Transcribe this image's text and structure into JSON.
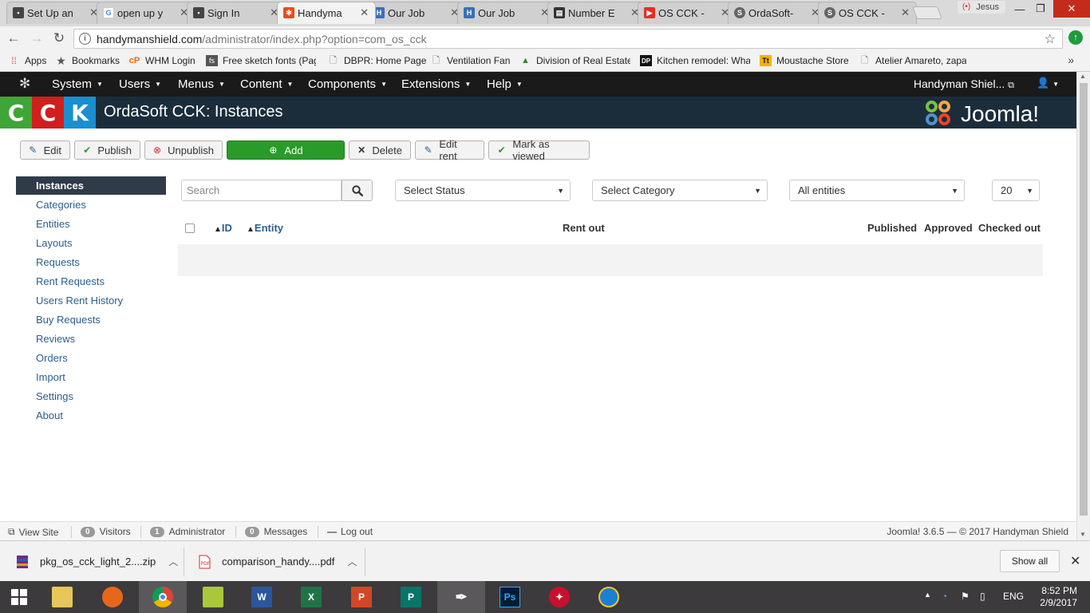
{
  "browser": {
    "tabs": [
      {
        "label": "Set Up an",
        "icon": "square-icon",
        "color": "#444444"
      },
      {
        "label": "open up y",
        "icon": "google-icon",
        "color": "#4285f4"
      },
      {
        "label": "Sign In",
        "icon": "square-icon",
        "color": "#444444"
      },
      {
        "label": "Handyma",
        "icon": "joomla-icon",
        "color": "#e84c1e"
      },
      {
        "label": "Our Job",
        "icon": "shield-icon",
        "color": "#3b6fb6"
      },
      {
        "label": "Our Job",
        "icon": "shield-icon",
        "color": "#3b6fb6"
      },
      {
        "label": "Number E",
        "icon": "book-icon",
        "color": "#333333"
      },
      {
        "label": "OS CCK -",
        "icon": "youtube-icon",
        "color": "#e52d27"
      },
      {
        "label": "OrdaSoft-",
        "icon": "ordasoft-icon",
        "color": "#666666"
      },
      {
        "label": "OS CCK -",
        "icon": "ordasoft-icon",
        "color": "#666666"
      }
    ],
    "profile_name": "Jesus",
    "url_host": "handymanshield.com",
    "url_path": "/administrator/index.php?option=com_os_cck",
    "bookmarks": [
      {
        "label": "Apps",
        "icon": "apps-grid-icon"
      },
      {
        "label": "Bookmarks",
        "icon": "star-icon"
      },
      {
        "label": "WHM Login",
        "icon": "cpanel-icon"
      },
      {
        "label": "Free sketch fonts (Pag",
        "icon": "fs-icon"
      },
      {
        "label": "DBPR: Home Page",
        "icon": "page-icon"
      },
      {
        "label": "Ventilation Fan",
        "icon": "page-icon"
      },
      {
        "label": "Division of Real Estate",
        "icon": "triangle-icon"
      },
      {
        "label": "Kitchen remodel: Wha",
        "icon": "dp-icon"
      },
      {
        "label": "Moustache Store",
        "icon": "tt-icon"
      },
      {
        "label": "Atelier Amareto, zapa",
        "icon": "page-icon"
      }
    ]
  },
  "joomla": {
    "menu": [
      "System",
      "Users",
      "Menus",
      "Content",
      "Components",
      "Extensions",
      "Help"
    ],
    "user": "Handyman Shiel...",
    "cck_letters": [
      "C",
      "C",
      "K"
    ],
    "page_title": "OrdaSoft CCK: Instances",
    "brand": "Joomla!",
    "toolbar": {
      "edit": "Edit",
      "publish": "Publish",
      "unpublish": "Unpublish",
      "add": "Add",
      "delete": "Delete",
      "edit_rent": "Edit rent",
      "mark_viewed": "Mark as viewed"
    },
    "sidebar": [
      "Instances",
      "Categories",
      "Entities",
      "Layouts",
      "Requests",
      "Rent Requests",
      "Users Rent History",
      "Buy Requests",
      "Reviews",
      "Orders",
      "Import",
      "Settings",
      "About"
    ],
    "filters": {
      "search_placeholder": "Search",
      "status": "Select Status",
      "category": "Select Category",
      "entities": "All entities",
      "limit": "20"
    },
    "table_headers": {
      "id": "ID",
      "entity": "Entity",
      "rent_out": "Rent out",
      "published": "Published",
      "approved": "Approved",
      "checked_out": "Checked out"
    },
    "footer": {
      "view_site": "View Site",
      "visitors_count": "0",
      "visitors": "Visitors",
      "admin_count": "1",
      "administrator": "Administrator",
      "messages_count": "0",
      "messages": "Messages",
      "logout": "Log out",
      "copyright": "Joomla! 3.6.5  —  © 2017 Handyman Shield"
    }
  },
  "downloads": [
    {
      "name": "pkg_os_cck_light_2....zip",
      "icon": "archive-icon"
    },
    {
      "name": "comparison_handy....pdf",
      "icon": "pdf-icon"
    }
  ],
  "show_all": "Show all",
  "taskbar": {
    "lang": "ENG",
    "time": "8:52 PM",
    "date": "2/9/2017"
  }
}
